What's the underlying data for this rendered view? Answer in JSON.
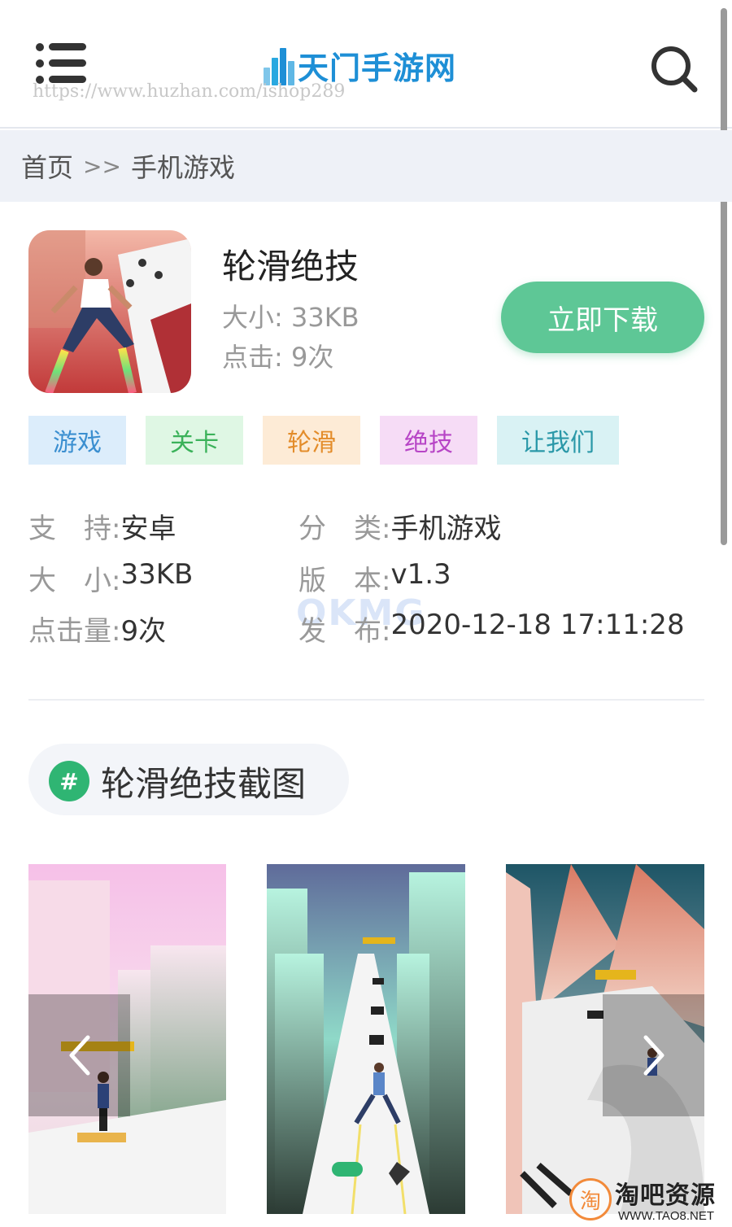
{
  "header": {
    "logo_text": "天门手游网",
    "watermark_url": "https://www.huzhan.com/ishop289",
    "brand_color": "#1e8fd6"
  },
  "breadcrumb": {
    "home": "首页",
    "separator": ">>",
    "current": "手机游戏"
  },
  "app": {
    "name": "轮滑绝技",
    "size_label": "大小:",
    "size_value": "33KB",
    "clicks_label": "点击:",
    "clicks_value": "9次",
    "download_label": "立即下载",
    "download_color": "#5ec796"
  },
  "tags": [
    {
      "label": "游戏",
      "bg": "#dcedfb",
      "color": "#3b8fd0"
    },
    {
      "label": "关卡",
      "bg": "#dff7e4",
      "color": "#3bb25a"
    },
    {
      "label": "轮滑",
      "bg": "#fdebd6",
      "color": "#e38c2a"
    },
    {
      "label": "绝技",
      "bg": "#f6dcf6",
      "color": "#b745c6"
    },
    {
      "label": "让我们",
      "bg": "#d9f2f4",
      "color": "#2a98a8"
    }
  ],
  "details": {
    "support_label": "支　持:",
    "support_value": "安卓",
    "category_label": "分　类:",
    "category_value": "手机游戏",
    "size_label": "大　小:",
    "size_value": "33KB",
    "version_label": "版　本:",
    "version_value": "v1.3",
    "clicks_label": "点击量:",
    "clicks_value": "9次",
    "publish_label": "发　布:",
    "publish_value": "2020-12-18 17:11:28",
    "watermark": "OKMG"
  },
  "screenshots": {
    "hash": "#",
    "title": "轮滑绝技截图"
  },
  "corner_watermark": {
    "circle_char": "淘",
    "name": "淘吧资源",
    "url": "WWW.TAO8.NET"
  }
}
